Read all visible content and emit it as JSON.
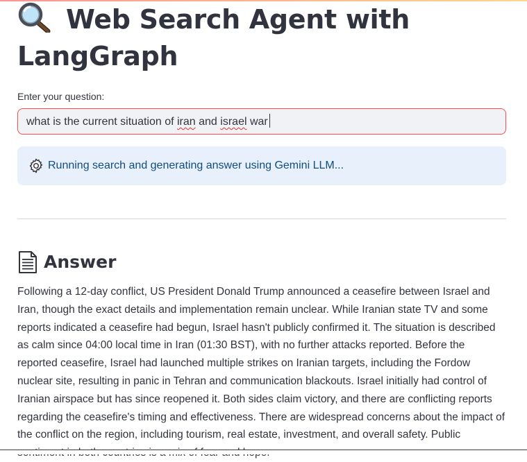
{
  "app": {
    "title_emoji": "🔍",
    "title": "Web Search Agent with LangGraph"
  },
  "question": {
    "label": "Enter your question:",
    "value_parts": [
      "what is the current situation of ",
      "iran",
      " and ",
      "israel",
      " war"
    ]
  },
  "status": {
    "icon": "gear-icon",
    "text": "Running search and generating answer using Gemini LLM..."
  },
  "answer": {
    "icon": "document-icon",
    "heading": "Answer",
    "text": "Following a 12-day conflict, US President Donald Trump announced a ceasefire between Israel and Iran, though the exact details and implementation remain unclear. While Iranian state TV and some reports indicated a ceasefire had begun, Israel hasn't publicly confirmed it. The situation is described as calm since 04:00 local time in Iran (01:30 BST), with no further attacks reported. Before the reported ceasefire, Israel had launched multiple strikes on Iranian targets, including the Fordow nuclear site, resulting in panic in Tehran and communication blackouts. Israel initially had control of Iranian airspace but has since reopened it. Both sides claim victory, and there are conflicting reports regarding the ceasefire's timing and effectiveness. There are widespread concerns about the impact of the conflict on the region, including tourism, real estate, investment, and overall safety. Public sentiment in both countries is a mix of fear and hope."
  },
  "colors": {
    "input_border": "#ff4b4b",
    "status_bg": "#e8f1fb",
    "status_text": "#0f4c81",
    "text": "#31333f"
  }
}
